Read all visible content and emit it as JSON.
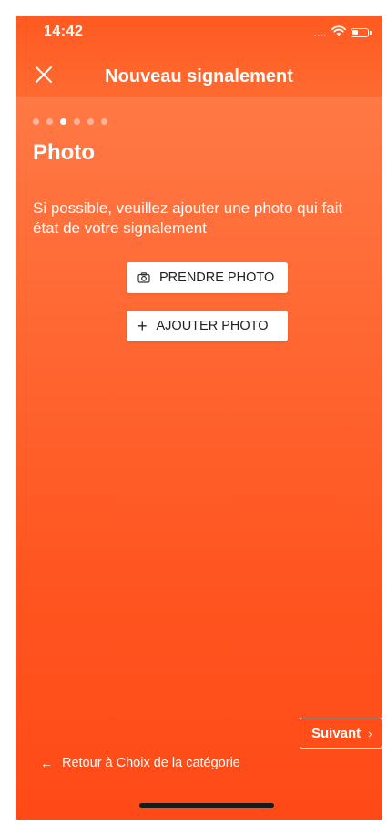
{
  "status_bar": {
    "time": "14:42",
    "signal": "....",
    "icons": [
      "wifi-icon",
      "battery-icon"
    ]
  },
  "header": {
    "title": "Nouveau signalement",
    "close_icon": "close-icon"
  },
  "steps": {
    "total": 6,
    "current": 3
  },
  "page": {
    "title": "Photo",
    "description": "Si possible, veuillez ajouter une photo qui fait état de votre signalement"
  },
  "actions": {
    "take_photo_label": "PRENDRE PHOTO",
    "take_photo_icon": "camera-icon",
    "add_photo_label": "AJOUTER PHOTO",
    "add_photo_icon": "plus-icon"
  },
  "footer": {
    "next_label": "Suivant",
    "next_icon": "chevron-right-icon",
    "back_label": "Retour à Choix de la catégorie",
    "back_icon": "arrow-left-icon"
  },
  "colors": {
    "accent_orange": "#ff5a22",
    "background_gradient_top": "#ff7f4c",
    "background_gradient_bottom": "#ff4a17",
    "button_bg": "#ffffff",
    "text_light": "#ffffff"
  }
}
